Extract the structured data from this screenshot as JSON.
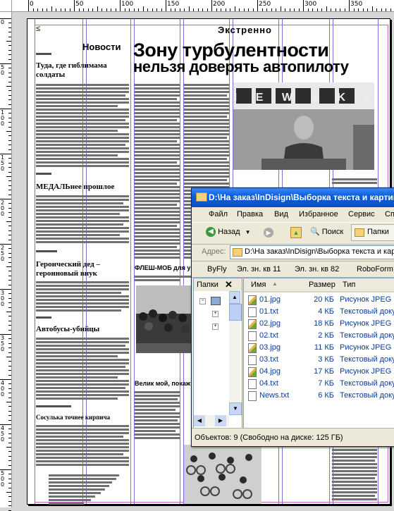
{
  "ruler": {
    "top_labels": [
      "0",
      "50",
      "100",
      "150",
      "200",
      "250",
      "300",
      "350"
    ],
    "left_labels": [
      "0",
      "50",
      "100",
      "150",
      "200",
      "250",
      "300",
      "350",
      "400",
      "450",
      "500"
    ]
  },
  "newspaper": {
    "tab_mark": "≤",
    "section_urgent": "Экстренно",
    "section_news": "Новости",
    "headline_line1": "Зону турбулентности",
    "headline_line2": "нельзя доверять автопилоту",
    "news_photo_sign": "N E W S  K Z",
    "articles": [
      "Туда, где гиблимама солдаты",
      "МЕДАЛЬнее прошлое",
      "Героический дед – геронновый внук",
      "Автобусы-убийцы",
      "Сосулька точнее кирпича"
    ],
    "mid_heading_1": "ФЛЕШ-МОБ для у",
    "mid_heading_2": "Велик мой, покаж"
  },
  "window": {
    "title": "D:\\На заказ\\InDisign\\Выборка текста и картинок",
    "menu": [
      "Файл",
      "Правка",
      "Вид",
      "Избранное",
      "Сервис",
      "Справка"
    ],
    "back_label": "Назад",
    "search_label": "Поиск",
    "folders_label": "Папки",
    "address_label": "Адрес:",
    "address_value": "D:\\На заказ\\InDisign\\Выборка текста и картинок",
    "links": [
      "ByFly",
      "Эл. зн. кв 11",
      "Эл. зн. кв 82",
      "RoboForm"
    ],
    "folders_pane_title": "Папки",
    "columns": {
      "name": "Имя",
      "size": "Размер",
      "type": "Тип"
    },
    "files": [
      {
        "name": "01.jpg",
        "size": "20 КБ",
        "type": "Рисунок JPEG",
        "icon": "jpg"
      },
      {
        "name": "01.txt",
        "size": "4 КБ",
        "type": "Текстовый документ",
        "icon": "txt"
      },
      {
        "name": "02.jpg",
        "size": "18 КБ",
        "type": "Рисунок JPEG",
        "icon": "jpg"
      },
      {
        "name": "02.txt",
        "size": "2 КБ",
        "type": "Текстовый документ",
        "icon": "txt"
      },
      {
        "name": "03.jpg",
        "size": "11 КБ",
        "type": "Рисунок JPEG",
        "icon": "jpg"
      },
      {
        "name": "03.txt",
        "size": "3 КБ",
        "type": "Текстовый документ",
        "icon": "txt"
      },
      {
        "name": "04.jpg",
        "size": "17 КБ",
        "type": "Рисунок JPEG",
        "icon": "jpg"
      },
      {
        "name": "04.txt",
        "size": "7 КБ",
        "type": "Текстовый документ",
        "icon": "txt"
      },
      {
        "name": "News.txt",
        "size": "6 КБ",
        "type": "Текстовый документ",
        "icon": "txt"
      }
    ],
    "status": "Объектов: 9 (Свободно на диске: 125 ГБ)",
    "colors": {
      "title_bar": "#0a5fd8",
      "face": "#ece9d8",
      "link_text": "#0a3c9c"
    }
  }
}
